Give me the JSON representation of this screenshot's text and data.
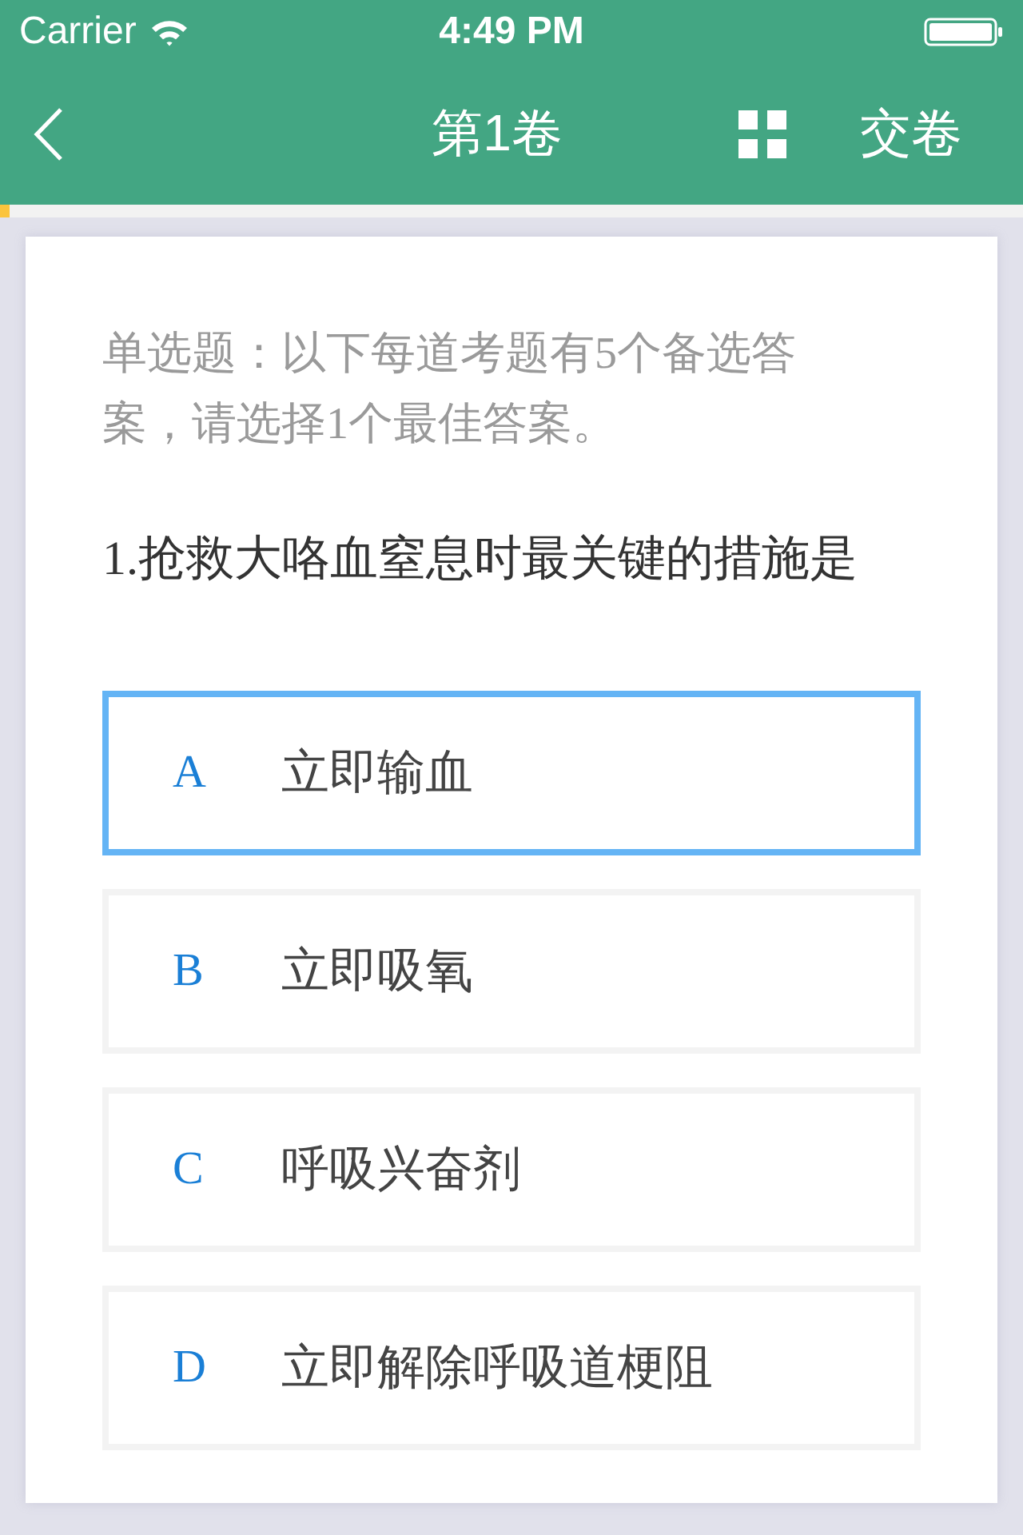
{
  "status_bar": {
    "carrier": "Carrier",
    "time": "4:49 PM"
  },
  "nav_bar": {
    "title": "第1卷",
    "submit": "交卷"
  },
  "progress": {
    "level": 0.01
  },
  "instruction": "单选题：以下每道考题有5个备选答案，请选择1个最佳答案。",
  "question": "1.抢救大咯血窒息时最关键的措施是",
  "options": [
    {
      "letter": "A",
      "text": "立即输血",
      "selected": true
    },
    {
      "letter": "B",
      "text": "立即吸氧",
      "selected": false
    },
    {
      "letter": "C",
      "text": "呼吸兴奋剂",
      "selected": false
    },
    {
      "letter": "D",
      "text": "立即解除呼吸道梗阻",
      "selected": false
    }
  ]
}
